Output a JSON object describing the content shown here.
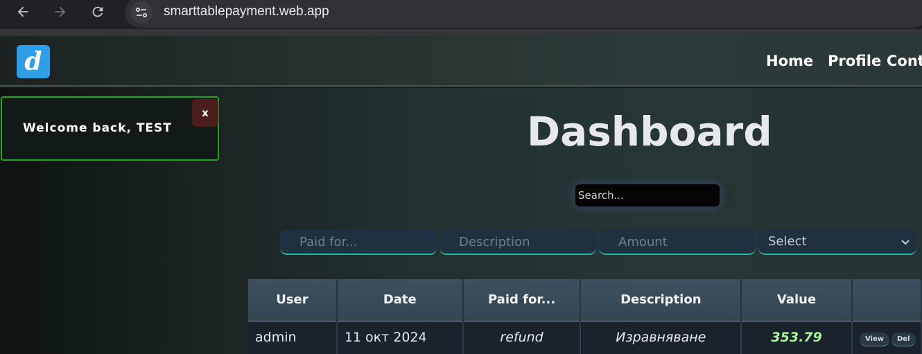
{
  "browser": {
    "url": "smarttablepayment.web.app",
    "back_icon": "arrow-left-icon",
    "forward_icon": "arrow-right-icon",
    "reload_icon": "reload-icon",
    "site_info_icon": "tune-icon"
  },
  "header": {
    "logo_letter": "d",
    "nav": [
      "Home",
      "Profile",
      "Cont"
    ]
  },
  "toast": {
    "message": "Welcome back, TEST",
    "close_label": "x",
    "border_color": "#1fa81f"
  },
  "main": {
    "title": "Dashboard",
    "search_placeholder": "Search..."
  },
  "form": {
    "paid_for_placeholder": "Paid for...",
    "description_placeholder": "Description",
    "amount_placeholder": "Amount",
    "select_value": "Select"
  },
  "table": {
    "columns": [
      "User",
      "Date",
      "Paid for...",
      "Description",
      "Value",
      ""
    ],
    "rows": [
      {
        "user": "admin",
        "date": "11 окт 2024",
        "paid_for": "refund",
        "description": "Изравняване",
        "value": "353.79",
        "actions": [
          "View",
          "Del"
        ]
      }
    ]
  },
  "colors": {
    "accent": "#28b7a8",
    "value": "#a8f59a",
    "logo": "#2f9ee8"
  }
}
